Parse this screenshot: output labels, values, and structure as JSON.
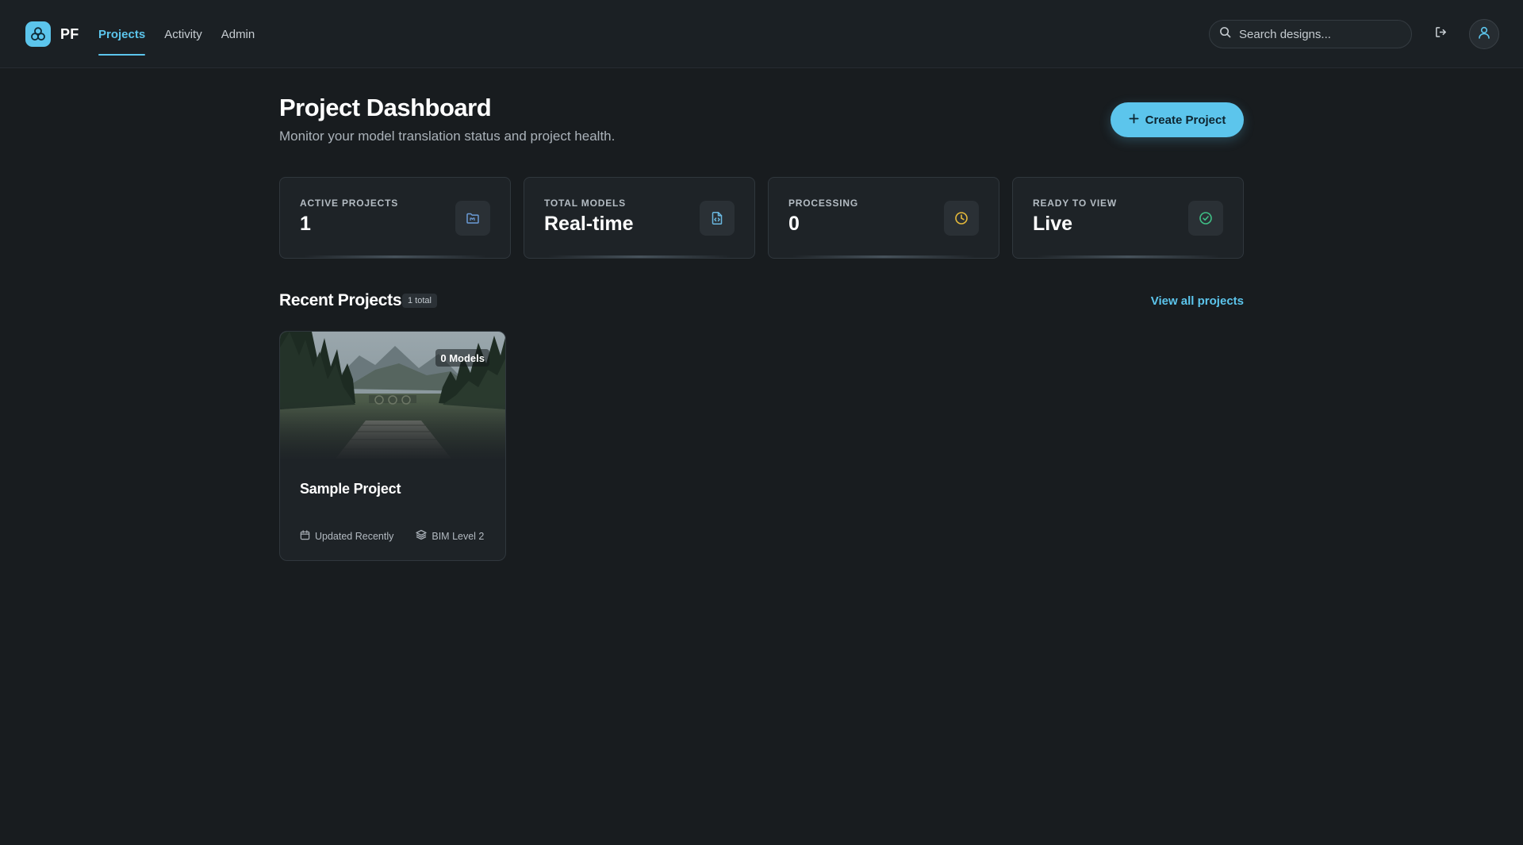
{
  "brand": {
    "name": "PF",
    "icon": "three-circles-logo-icon",
    "color": "#5cc5ec"
  },
  "nav": {
    "tabs": [
      {
        "label": "Projects",
        "active": true
      },
      {
        "label": "Activity",
        "active": false
      },
      {
        "label": "Admin",
        "active": false
      }
    ]
  },
  "search": {
    "placeholder": "Search designs...",
    "value": "",
    "icon": "search-icon"
  },
  "header_actions": {
    "logout_icon": "logout-icon",
    "avatar_icon": "user-icon"
  },
  "page": {
    "title": "Project Dashboard",
    "subtitle": "Monitor your model translation status and project health."
  },
  "create_button": {
    "label": "Create Project",
    "icon": "plus-icon"
  },
  "stats": [
    {
      "label": "ACTIVE PROJECTS",
      "value": "1",
      "icon": "folder-icon",
      "color": "#6b9bd6"
    },
    {
      "label": "TOTAL MODELS",
      "value": "Real-time",
      "icon": "file-code-icon",
      "color": "#6ab8e0"
    },
    {
      "label": "PROCESSING",
      "value": "0",
      "icon": "clock-icon",
      "color": "#e5b93a"
    },
    {
      "label": "READY TO VIEW",
      "value": "Live",
      "icon": "check-circle-icon",
      "color": "#3fbf86"
    }
  ],
  "recent": {
    "title": "Recent Projects",
    "count_label": "1 total",
    "view_all_label": "View all projects"
  },
  "projects": [
    {
      "name": "Sample Project",
      "models_label": "0 Models",
      "updated_label": "Updated Recently",
      "level_label": "BIM Level 2",
      "thumbnail": "mountain-lake-dock-photo"
    }
  ],
  "colors": {
    "background": "#181c1f",
    "surface": "#1e2327",
    "accent": "#5cc5ec"
  }
}
